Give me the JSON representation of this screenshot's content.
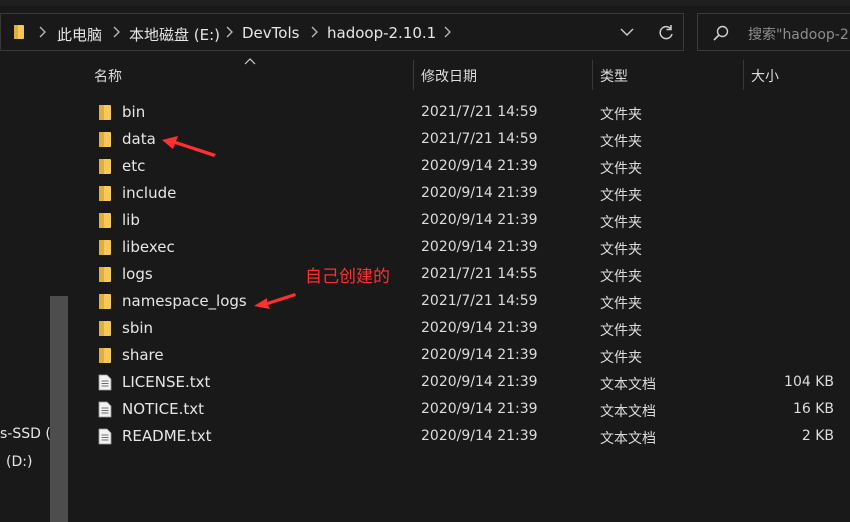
{
  "address_bar": {
    "breadcrumbs": [
      "此电脑",
      "本地磁盘 (E:)",
      "DevTols",
      "hadoop-2.10.1"
    ]
  },
  "search": {
    "placeholder": "搜索\"hadoop-2"
  },
  "nav_pane": {
    "items": [
      "s-SSD (",
      "(D:)"
    ]
  },
  "columns": {
    "name": "名称",
    "date": "修改日期",
    "type": "类型",
    "size": "大小"
  },
  "files": [
    {
      "name": "bin",
      "date": "2021/7/21 14:59",
      "type": "文件夹",
      "size": "",
      "icon": "folder-icon"
    },
    {
      "name": "data",
      "date": "2021/7/21 14:59",
      "type": "文件夹",
      "size": "",
      "icon": "folder-icon"
    },
    {
      "name": "etc",
      "date": "2020/9/14 21:39",
      "type": "文件夹",
      "size": "",
      "icon": "folder-icon"
    },
    {
      "name": "include",
      "date": "2020/9/14 21:39",
      "type": "文件夹",
      "size": "",
      "icon": "folder-icon"
    },
    {
      "name": "lib",
      "date": "2020/9/14 21:39",
      "type": "文件夹",
      "size": "",
      "icon": "folder-icon"
    },
    {
      "name": "libexec",
      "date": "2020/9/14 21:39",
      "type": "文件夹",
      "size": "",
      "icon": "folder-icon"
    },
    {
      "name": "logs",
      "date": "2021/7/21 14:55",
      "type": "文件夹",
      "size": "",
      "icon": "folder-icon"
    },
    {
      "name": "namespace_logs",
      "date": "2021/7/21 14:59",
      "type": "文件夹",
      "size": "",
      "icon": "folder-icon"
    },
    {
      "name": "sbin",
      "date": "2020/9/14 21:39",
      "type": "文件夹",
      "size": "",
      "icon": "folder-icon"
    },
    {
      "name": "share",
      "date": "2020/9/14 21:39",
      "type": "文件夹",
      "size": "",
      "icon": "folder-icon"
    },
    {
      "name": "LICENSE.txt",
      "date": "2020/9/14 21:39",
      "type": "文本文档",
      "size": "104 KB",
      "icon": "text-file-icon"
    },
    {
      "name": "NOTICE.txt",
      "date": "2020/9/14 21:39",
      "type": "文本文档",
      "size": "16 KB",
      "icon": "text-file-icon"
    },
    {
      "name": "README.txt",
      "date": "2020/9/14 21:39",
      "type": "文本文档",
      "size": "2 KB",
      "icon": "text-file-icon"
    }
  ],
  "annotation": {
    "text": "自己创建的",
    "color": "#ff3030"
  },
  "colors": {
    "folder": "#f4c85a",
    "background": "#191919",
    "annotation_red": "#ff3030"
  }
}
